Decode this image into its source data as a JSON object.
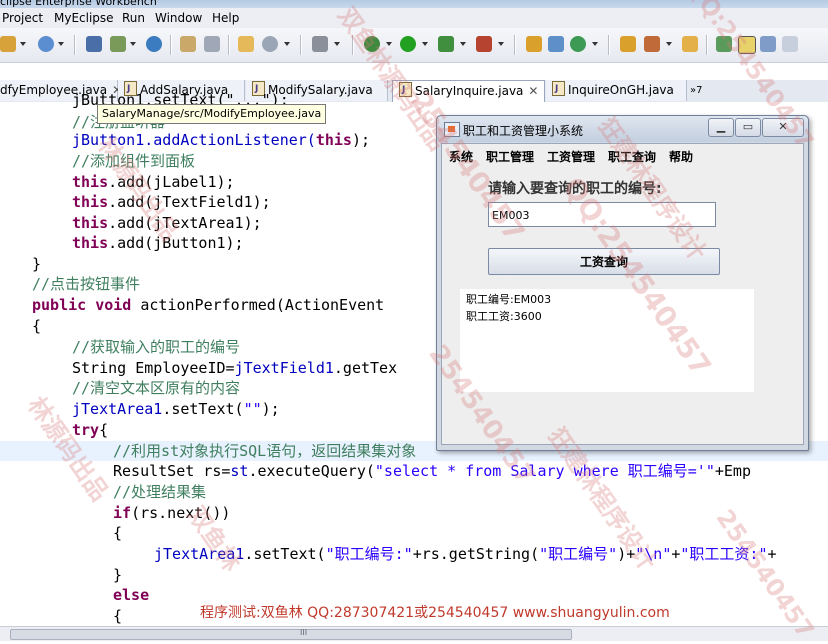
{
  "window_title": "clipse Enterprise Workbench",
  "menu": [
    "Project",
    "MyEclipse",
    "Run",
    "Window",
    "Help"
  ],
  "tabs": [
    {
      "label": "dfyEmployee.java",
      "has_close": true
    },
    {
      "label": "AddSalary.java"
    },
    {
      "label": "ModifySalary.java"
    },
    {
      "label": "SalaryInquire.java",
      "has_close": true,
      "active": true
    },
    {
      "label": "InquireOnGH.java"
    },
    {
      "label": "»7"
    }
  ],
  "tooltip": "SalaryManage/src/ModifyEmployee.java",
  "code": {
    "l0_partial": "jButton1.setText(\"...\");",
    "l1_comment": "//注册监听器",
    "l2a": "jButton1.addActionListener(",
    "l2b": "this",
    "l2c": ");",
    "l3": "//添加组件到面板",
    "l4_kw": "this",
    "l4_rest": ".add(jLabel1);",
    "l5_kw": "this",
    "l5_rest": ".add(jTextField1);",
    "l6_kw": "this",
    "l6_rest": ".add(jTextArea1);",
    "l7_kw": "this",
    "l7_rest": ".add(jButton1);",
    "l8": "}",
    "l9": "//点击按钮事件",
    "l10_kw": "public void",
    "l10_rest": " actionPerformed(ActionEvent",
    "l11": "{",
    "l12": "//获取输入的职工的编号",
    "l13_a": "String EmployeeID=",
    "l13_b": "jTextField1",
    "l13_c": ".getTex",
    "l14": "//清空文本区原有的内容",
    "l15_a": "jTextArea1",
    "l15_b": ".setText(",
    "l15_c": "\"\"",
    "l15_d": ");",
    "l16_kw": "try",
    "l16_rest": "{",
    "l17": "//利用st对象执行SQL语句，返回结果集对象",
    "l18_a": "ResultSet rs=",
    "l18_b": "st",
    "l18_c": ".executeQuery(",
    "l18_d": "\"select * from Salary where 职工编号='\"",
    "l18_e": "+Emp",
    "l19": "//处理结果集",
    "l20_kw": "if",
    "l20_rest": "(rs.next())",
    "l21": "{",
    "l22_a": "jTextArea1",
    "l22_b": ".setText(",
    "l22_c": "\"职工编号:\"",
    "l22_d": "+rs.getString(",
    "l22_e": "\"职工编号\"",
    "l22_f": ")+",
    "l22_g": "\"\\n\"",
    "l22_h": "+",
    "l22_i": "\"职工工资:\"",
    "l22_j": "+",
    "l23": "}",
    "l24_kw": "else",
    "l25": "{"
  },
  "app": {
    "title": "职工和工资管理小系统",
    "menu": [
      "系统",
      "职工管理",
      "工资管理",
      "职工查询",
      "帮助"
    ],
    "prompt": "请输入要查询的职工的编号:",
    "input_value": "EM003",
    "button_label": "工资查询",
    "result_line1": "职工编号:EM003",
    "result_line2": "职工工资:3600"
  },
  "watermark_text": [
    "双鱼林",
    "254540457",
    "QQ:254540457",
    "狂建林程序设计",
    "双鱼林源码出品",
    "林源码出品"
  ],
  "promo_text": "程序测试:双鱼林 QQ:287307421或254540457 www.shuangyulin.com",
  "scrollbar_grip": "III",
  "colors": {
    "keyword": "#7f0055",
    "comment": "#3f7f5f",
    "string": "#2a00ff",
    "field": "#0000c0",
    "watermark": "#d77878"
  }
}
